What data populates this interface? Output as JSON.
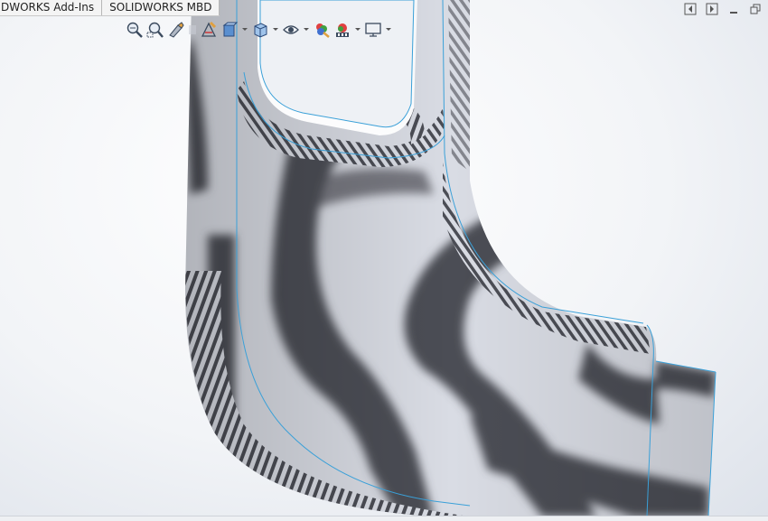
{
  "tabs": [
    {
      "label": "DWORKS Add-Ins"
    },
    {
      "label": "SOLIDWORKS MBD"
    }
  ],
  "heads_up_toolbar": {
    "icons": [
      "zoom-to-fit-icon",
      "zoom-to-area-icon",
      "previous-view-icon",
      "section-view-icon",
      "dynamic-annotation-views-icon",
      "view-orientation-icon",
      "display-style-icon",
      "hide-show-items-icon",
      "edit-appearance-icon",
      "apply-scene-icon",
      "view-settings-icon"
    ]
  },
  "colors": {
    "zebra_dark": "#4b4d55",
    "zebra_light": "#d9dce4",
    "edge_highlight": "#3aa0d8",
    "viewport_bg": "#eef1f5"
  }
}
